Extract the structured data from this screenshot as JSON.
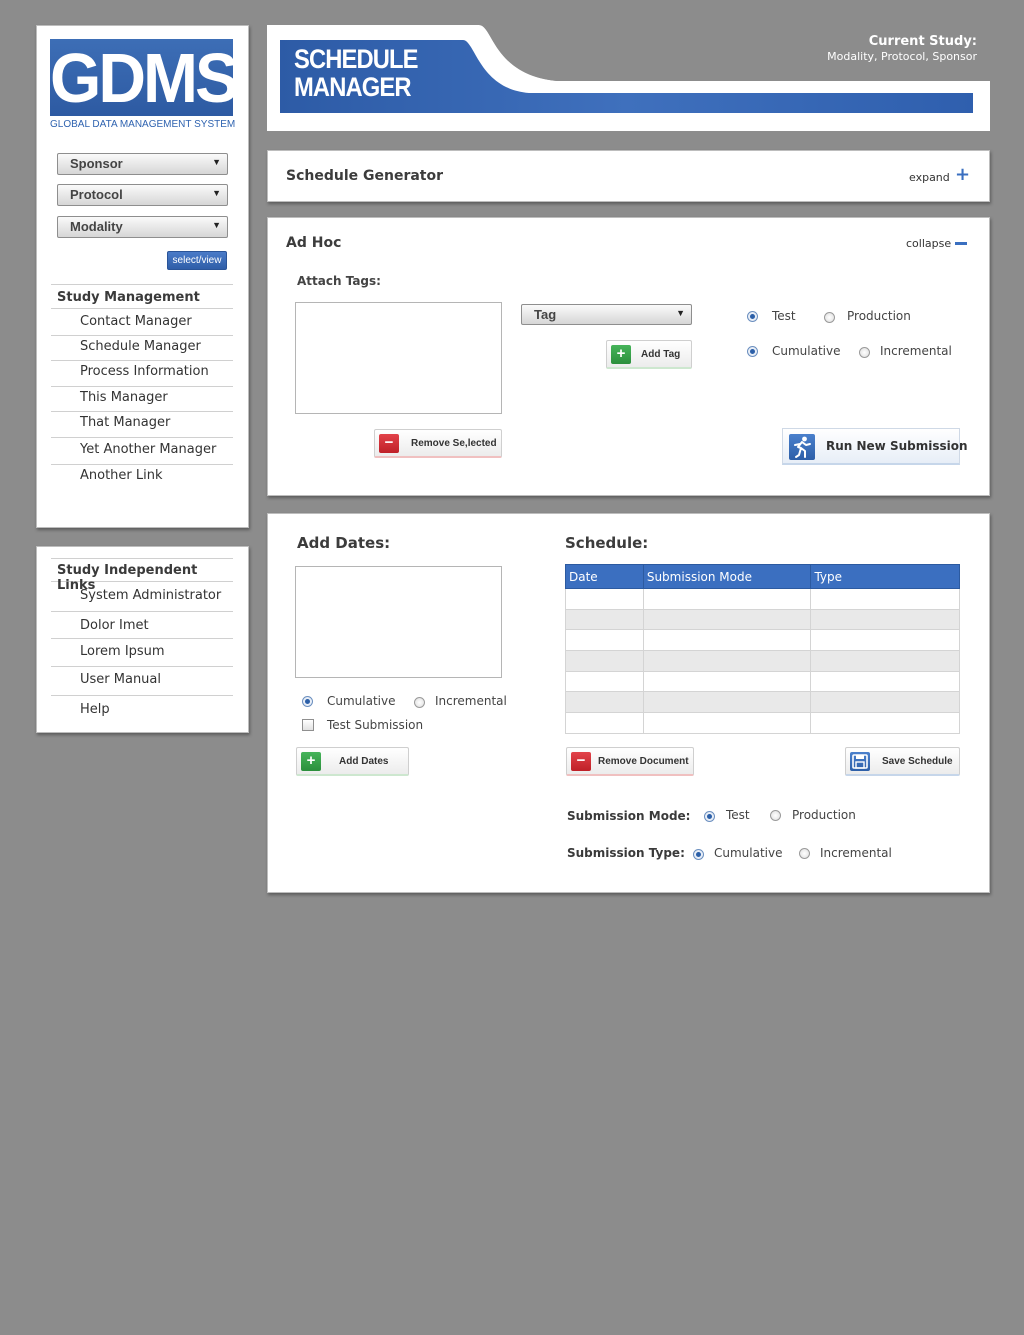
{
  "logo": {
    "text": "GDMS",
    "subtitle": "GLOBAL DATA MANAGEMENT SYSTEM"
  },
  "selectors": {
    "sponsor": "Sponsor",
    "protocol": "Protocol",
    "modality": "Modality",
    "select_view": "select/view"
  },
  "study_management": {
    "heading": "Study Management",
    "items": [
      "Contact Manager",
      "Schedule Manager",
      "Process Information",
      "This Manager",
      "That Manager",
      "Yet Another Manager",
      "Another Link"
    ]
  },
  "independent_links": {
    "heading": "Study Independent Links",
    "items": [
      "System Administrator",
      "Dolor Imet",
      "Lorem Ipsum",
      "User Manual",
      "Help"
    ]
  },
  "header": {
    "title_line1": "SCHEDULE",
    "title_line2": "MANAGER",
    "current_study_label": "Current Study:",
    "current_study_value": "Modality, Protocol, Sponsor"
  },
  "schedule_generator": {
    "title": "Schedule Generator",
    "toggle": "expand"
  },
  "ad_hoc": {
    "title": "Ad Hoc",
    "toggle": "collapse",
    "attach_tags": "Attach Tags:",
    "tag_select": "Tag",
    "add_tag": "Add Tag",
    "remove_selected": "Remove Se,lected",
    "env": {
      "test": "Test",
      "production": "Production",
      "selected": "Test"
    },
    "type": {
      "cumulative": "Cumulative",
      "incremental": "Incremental",
      "selected": "Cumulative"
    },
    "run_button": "Run New Submission"
  },
  "add_dates": {
    "title": "Add Dates:",
    "cumulative": "Cumulative",
    "incremental": "Incremental",
    "selected": "Cumulative",
    "test_submission": "Test Submission",
    "add_dates_button": "Add Dates"
  },
  "schedule": {
    "title": "Schedule:",
    "columns": [
      "Date",
      "Submission Mode",
      "Type"
    ],
    "rows": [
      [
        "",
        "",
        ""
      ],
      [
        "",
        "",
        ""
      ],
      [
        "",
        "",
        ""
      ],
      [
        "",
        "",
        ""
      ],
      [
        "",
        "",
        ""
      ],
      [
        "",
        "",
        ""
      ],
      [
        "",
        "",
        ""
      ]
    ],
    "remove_document": "Remove Document",
    "save_schedule": "Save Schedule",
    "submission_mode_label": "Submission Mode:",
    "submission_mode": {
      "test": "Test",
      "production": "Production",
      "selected": "Test"
    },
    "submission_type_label": "Submission Type:",
    "submission_type": {
      "cumulative": "Cumulative",
      "incremental": "Incremental",
      "selected": "Cumulative"
    }
  },
  "colors": {
    "brand_blue": "#3b6fc0",
    "background": "#8c8c8c",
    "add_green": "#2b8f3c",
    "remove_red": "#bf1f27"
  }
}
